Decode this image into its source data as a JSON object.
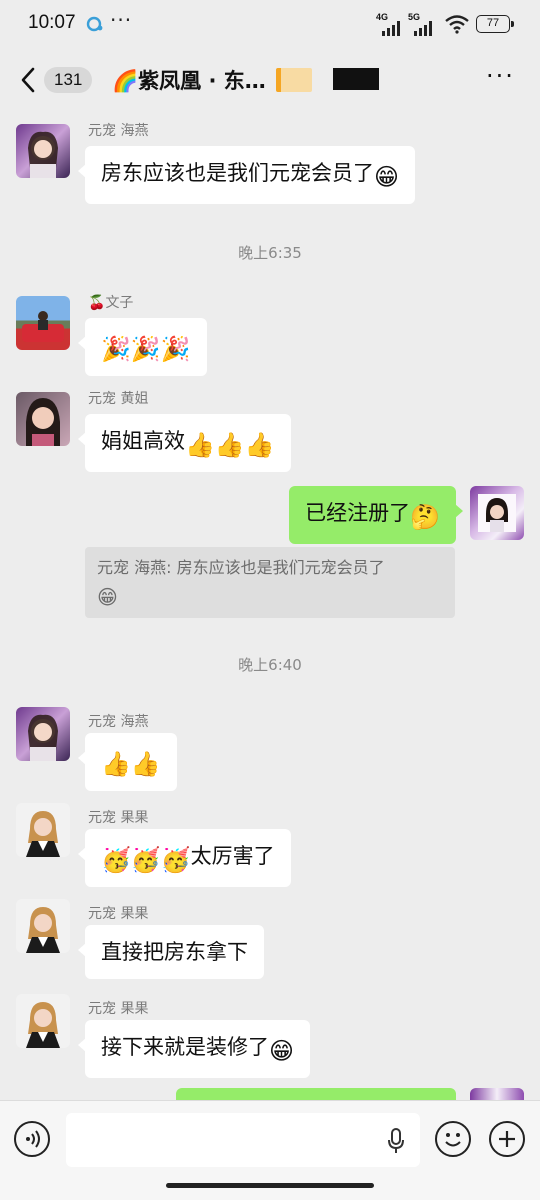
{
  "status_bar": {
    "time": "10:07",
    "dots": "···",
    "net1": "4G",
    "net2": "5G",
    "battery": "77"
  },
  "nav": {
    "unread_count": "131",
    "title": "🌈紫凤凰 · 东…",
    "more_icon": "more-dots-icon"
  },
  "messages": [
    {
      "sender": "元宠  海燕",
      "text": "房东应该也是我们元宠会员了",
      "emoji": "😁"
    },
    {
      "time": "晚上6:35"
    },
    {
      "sender_prefix": "🍒",
      "sender": "文子",
      "text": "",
      "emoji": "🎉🎉🎉"
    },
    {
      "sender": "元宠  黄姐",
      "text": "娟姐高效",
      "emoji": "👍👍👍"
    },
    {
      "self": true,
      "text": "已经注册了",
      "emoji": "🤔"
    },
    {
      "quote_line1": "元宠  海燕: 房东应该也是我们元宠会员了",
      "quote_emoji": "😁"
    },
    {
      "time": "晚上6:40"
    },
    {
      "sender": "元宠  海燕",
      "text": "",
      "emoji": "👍👍"
    },
    {
      "sender": "元宠  果果",
      "emoji_prefix": "🥳🥳🥳",
      "text": "太厉害了"
    },
    {
      "sender": "元宠  果果",
      "text": "直接把房东拿下"
    },
    {
      "sender": "元宠  果果",
      "text": "接下来就是装修了",
      "emoji": "😁"
    }
  ],
  "input": {
    "placeholder": "",
    "voice_icon": "voice-icon",
    "emoji_icon": "emoji-face-icon",
    "plus_icon": "plus-icon"
  }
}
